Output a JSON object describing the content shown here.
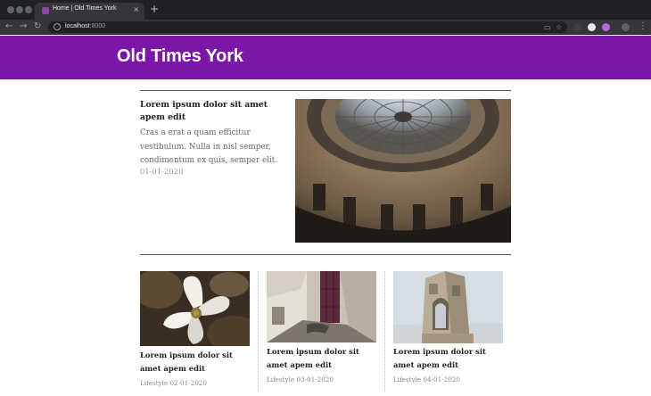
{
  "browser": {
    "tab_title": "Home | Old Times York",
    "tab_close": "×",
    "new_tab": "+",
    "url_host": "localhost",
    "url_port": ":8000"
  },
  "site": {
    "title": "Old Times York"
  },
  "featured": {
    "title": "Lorem ipsum dolor sit amet apem edit",
    "excerpt": "Cras a erat a quam efficitur vestibulum. Nulla in nisl semper, condimentum ex quis, semper elit.",
    "date": "01-01-2020",
    "image": "dome-interior-photo"
  },
  "cards": [
    {
      "title": "Lorem ipsum dolor sit amet apem edit",
      "category": "Lifestyle",
      "date": "02-01-2020",
      "image": "flower-photo"
    },
    {
      "title": "Lorem ipsum dolor sit amet apem edit",
      "category": "Lifestyle",
      "date": "03-01-2020",
      "image": "alley-photo"
    },
    {
      "title": "Lorem ipsum dolor sit amet apem edit",
      "category": "Lifestyle",
      "date": "04-01-2020",
      "image": "tower-photo"
    }
  ],
  "colors": {
    "header": "#7b16a9",
    "chrome": "#202124"
  }
}
